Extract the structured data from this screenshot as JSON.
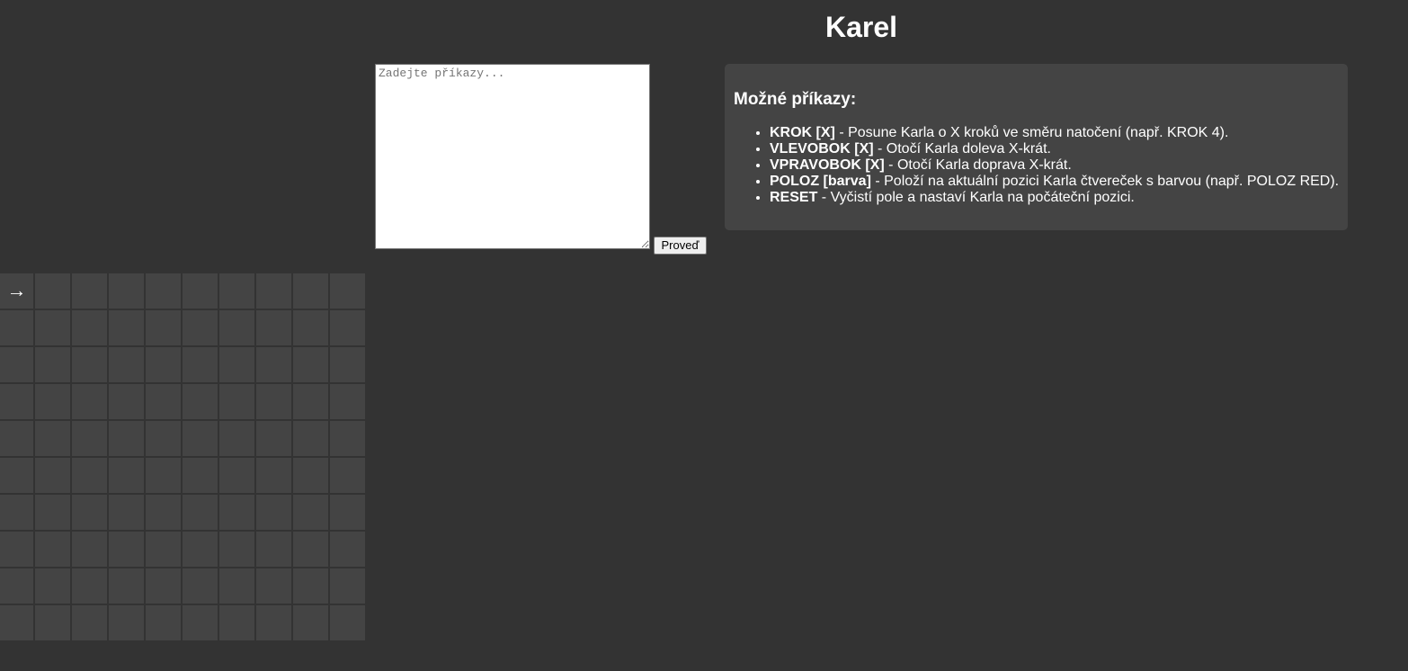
{
  "header": {
    "title": "Karel"
  },
  "editor": {
    "placeholder": "Zadejte příkazy...",
    "value": "",
    "run_label": "Proveď"
  },
  "help": {
    "title": "Možné příkazy:",
    "commands": [
      {
        "name": "KROK [X]",
        "description": " - Posune Karla o X kroků ve směru natočení (např. KROK 4)."
      },
      {
        "name": "VLEVOBOK [X]",
        "description": " - Otočí Karla doleva X-krát."
      },
      {
        "name": "VPRAVOBOK [X]",
        "description": " - Otočí Karla doprava X-krát."
      },
      {
        "name": "POLOZ [barva]",
        "description": " - Položí na aktuální pozici Karla čtvereček s barvou (např. POLOZ RED)."
      },
      {
        "name": "RESET",
        "description": " - Vyčistí pole a nastaví Karla na počáteční pozici."
      }
    ]
  },
  "board": {
    "rows": 10,
    "cols": 10,
    "karel": {
      "row": 0,
      "col": 0,
      "glyph": "→",
      "direction": "east"
    }
  },
  "colors": {
    "background": "#333333",
    "panel": "#444444",
    "cell": "#444444",
    "cell_border": "#333333",
    "text": "#ffffff"
  }
}
